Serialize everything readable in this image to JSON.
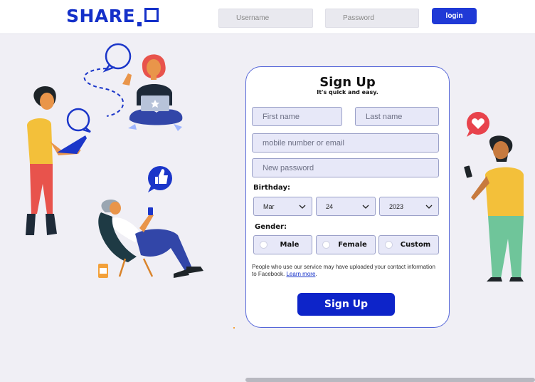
{
  "brand": {
    "logo_text": "SHARE"
  },
  "header": {
    "username_placeholder": "Username",
    "password_placeholder": "Password",
    "login_label": "login"
  },
  "signup": {
    "title": "Sign Up",
    "subtitle": "It's quick and easy.",
    "first_name_placeholder": "First name",
    "last_name_placeholder": "Last name",
    "contact_placeholder": "mobile number or email",
    "password_placeholder": "New password",
    "birthday_label": "Birthday:",
    "birthday": {
      "month": "Mar",
      "day": "24",
      "year": "2023"
    },
    "gender_label": "Gender:",
    "genders": [
      "Male",
      "Female",
      "Custom"
    ],
    "notice_text": "People who use our service may have uploaded your contact information to Facebook.",
    "learn_more": "Learn more",
    "notice_end": ".",
    "submit_label": "Sign Up"
  },
  "colors": {
    "accent": "#1531c9",
    "button": "#0d24c9",
    "background": "#f0eff5",
    "field": "#e7e8f8"
  },
  "icons": [
    "chevron-down-icon",
    "heart-icon",
    "thumbs-up-icon",
    "star-icon",
    "speech-bubble-icon"
  ]
}
